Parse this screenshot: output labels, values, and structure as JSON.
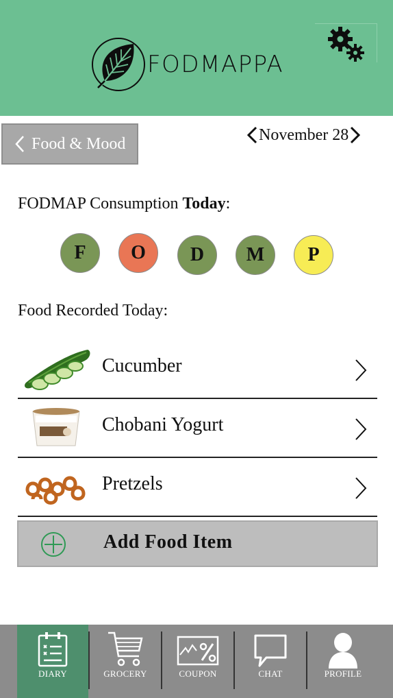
{
  "header": {
    "app_name": "FODMAPPA",
    "logo_icon": "leaf-icon",
    "settings_icon": "gears-icon"
  },
  "nav": {
    "back_label": "Food & Mood",
    "date": "November 28"
  },
  "consumption": {
    "prefix": "FODMAP Consumption ",
    "bold": "Today",
    "suffix": ":",
    "letters": [
      {
        "letter": "F",
        "color": "#7a9656"
      },
      {
        "letter": "O",
        "color": "#e97655"
      },
      {
        "letter": "D",
        "color": "#7a9656"
      },
      {
        "letter": "M",
        "color": "#7a9656"
      },
      {
        "letter": "P",
        "color": "#f7ec55"
      }
    ]
  },
  "foods": {
    "heading": "Food Recorded Today:",
    "items": [
      {
        "name": "Cucumber",
        "icon": "cucumber-image"
      },
      {
        "name": "Chobani Yogurt",
        "icon": "yogurt-image"
      },
      {
        "name": "Pretzels",
        "icon": "pretzels-image"
      }
    ],
    "add_label": "Add Food Item"
  },
  "tabbar": {
    "tabs": [
      {
        "label": "DIARY",
        "icon": "clipboard-icon",
        "active": true
      },
      {
        "label": "GROCERY",
        "icon": "cart-icon",
        "active": false
      },
      {
        "label": "COUPON",
        "icon": "coupon-icon",
        "active": false
      },
      {
        "label": "CHAT",
        "icon": "chat-icon",
        "active": false
      },
      {
        "label": "PROFILE",
        "icon": "person-icon",
        "active": false
      }
    ]
  },
  "colors": {
    "header_bg": "#6cbf92",
    "active_tab": "#4e8f6d",
    "tabbar_bg": "#8c8c8c"
  }
}
